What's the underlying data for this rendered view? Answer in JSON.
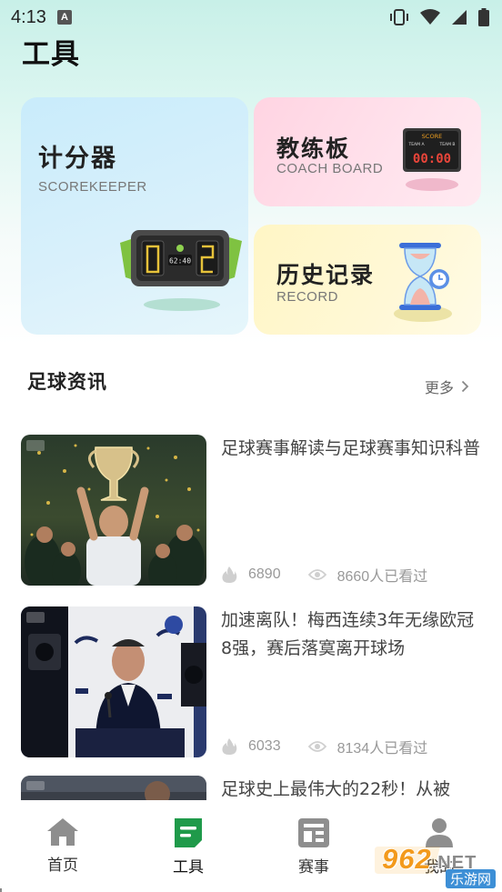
{
  "status_bar": {
    "time": "4:13",
    "notification_icon_letter": "A",
    "icons": [
      "vibrate-icon",
      "wifi-icon",
      "signal-icon",
      "battery-icon"
    ]
  },
  "page": {
    "title": "工具"
  },
  "cards": {
    "scorekeeper": {
      "title": "计分器",
      "subtitle": "SCOREKEEPER",
      "display": "62:40"
    },
    "coach_board": {
      "title": "教练板",
      "subtitle": "COACH BOARD",
      "board_header": "SCORE",
      "team_a": "TEAM A",
      "team_b": "TEAM B",
      "board_display": "00:00"
    },
    "record": {
      "title": "历史记录",
      "subtitle": "RECORD"
    }
  },
  "news": {
    "section_title": "足球资讯",
    "more_label": "更多",
    "items": [
      {
        "title": "足球赛事解读与足球赛事知识科普",
        "hot": "6890",
        "views": "8660人已看过"
      },
      {
        "title": "加速离队！梅西连续3年无缘欧冠8强，赛后落寞离开球场",
        "hot": "6033",
        "views": "8134人已看过"
      },
      {
        "title": "足球史上最伟大的22秒！从被"
      }
    ]
  },
  "bottom_nav": {
    "items": [
      {
        "label": "首页",
        "icon": "home-icon"
      },
      {
        "label": "工具",
        "icon": "tools-icon",
        "active": true
      },
      {
        "label": "赛事",
        "icon": "matches-icon"
      },
      {
        "label": "我的",
        "icon": "profile-icon"
      }
    ]
  },
  "watermark": {
    "text": "962",
    "suffix": ".NET",
    "sub": "乐游网"
  },
  "colors": {
    "accent": "#1f9a4a",
    "card_score_bg": "#d2eefb",
    "card_coach_bg": "#ffdce8",
    "card_record_bg": "#fff7cf",
    "nav_icon_inactive": "#8e8e8e"
  }
}
